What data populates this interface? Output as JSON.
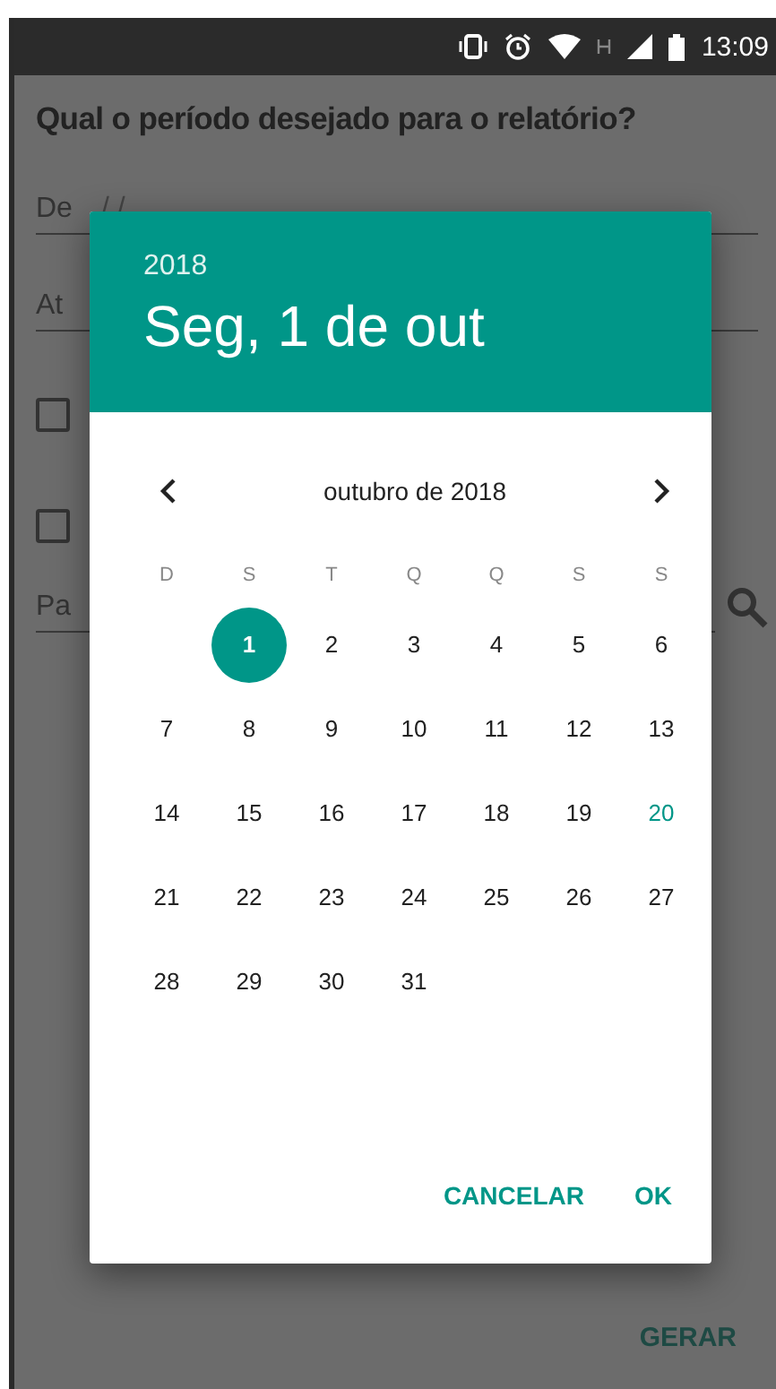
{
  "status_bar": {
    "time": "13:09"
  },
  "form": {
    "title": "Qual o período desejado para o relatório?",
    "fields": [
      {
        "label": "De",
        "value": "/ /"
      },
      {
        "label": "At"
      }
    ],
    "checkboxes": [
      {
        "checked": false
      },
      {
        "checked": false
      }
    ],
    "search_field": {
      "placeholder": "Pa"
    },
    "generate_button": "GERAR"
  },
  "date_picker": {
    "year": "2018",
    "date": "Seg, 1 de out",
    "month": "outubro de 2018",
    "weekdays": [
      "D",
      "S",
      "T",
      "Q",
      "Q",
      "S",
      "S"
    ],
    "weeks": [
      {
        "right_aligned": true,
        "days": [
          {
            "day": "1",
            "selected": true,
            "today": false
          },
          {
            "day": "2",
            "selected": false,
            "today": false
          },
          {
            "day": "3",
            "selected": false,
            "today": false
          },
          {
            "day": "4",
            "selected": false,
            "today": false
          },
          {
            "day": "5",
            "selected": false,
            "today": false
          },
          {
            "day": "6",
            "selected": false,
            "today": false
          }
        ]
      },
      {
        "days": [
          {
            "day": "7",
            "selected": false,
            "today": false
          },
          {
            "day": "8",
            "selected": false,
            "today": false
          },
          {
            "day": "9",
            "selected": false,
            "today": false
          },
          {
            "day": "10",
            "selected": false,
            "today": false
          },
          {
            "day": "11",
            "selected": false,
            "today": false
          },
          {
            "day": "12",
            "selected": false,
            "today": false
          },
          {
            "day": "13",
            "selected": false,
            "today": false
          }
        ]
      },
      {
        "days": [
          {
            "day": "14",
            "selected": false,
            "today": false
          },
          {
            "day": "15",
            "selected": false,
            "today": false
          },
          {
            "day": "16",
            "selected": false,
            "today": false
          },
          {
            "day": "17",
            "selected": false,
            "today": false
          },
          {
            "day": "18",
            "selected": false,
            "today": false
          },
          {
            "day": "19",
            "selected": false,
            "today": false
          },
          {
            "day": "20",
            "selected": false,
            "today": true
          }
        ]
      },
      {
        "days": [
          {
            "day": "21",
            "selected": false,
            "today": false
          },
          {
            "day": "22",
            "selected": false,
            "today": false
          },
          {
            "day": "23",
            "selected": false,
            "today": false
          },
          {
            "day": "24",
            "selected": false,
            "today": false
          },
          {
            "day": "25",
            "selected": false,
            "today": false
          },
          {
            "day": "26",
            "selected": false,
            "today": false
          },
          {
            "day": "27",
            "selected": false,
            "today": false
          }
        ]
      },
      {
        "right_aligned": false,
        "days": [
          {
            "day": "28",
            "selected": false,
            "today": false
          },
          {
            "day": "29",
            "selected": false,
            "today": false
          },
          {
            "day": "30",
            "selected": false,
            "today": false
          },
          {
            "day": "31",
            "selected": false,
            "today": false
          }
        ]
      }
    ],
    "buttons": [
      "CANCELAR",
      "OK"
    ]
  }
}
